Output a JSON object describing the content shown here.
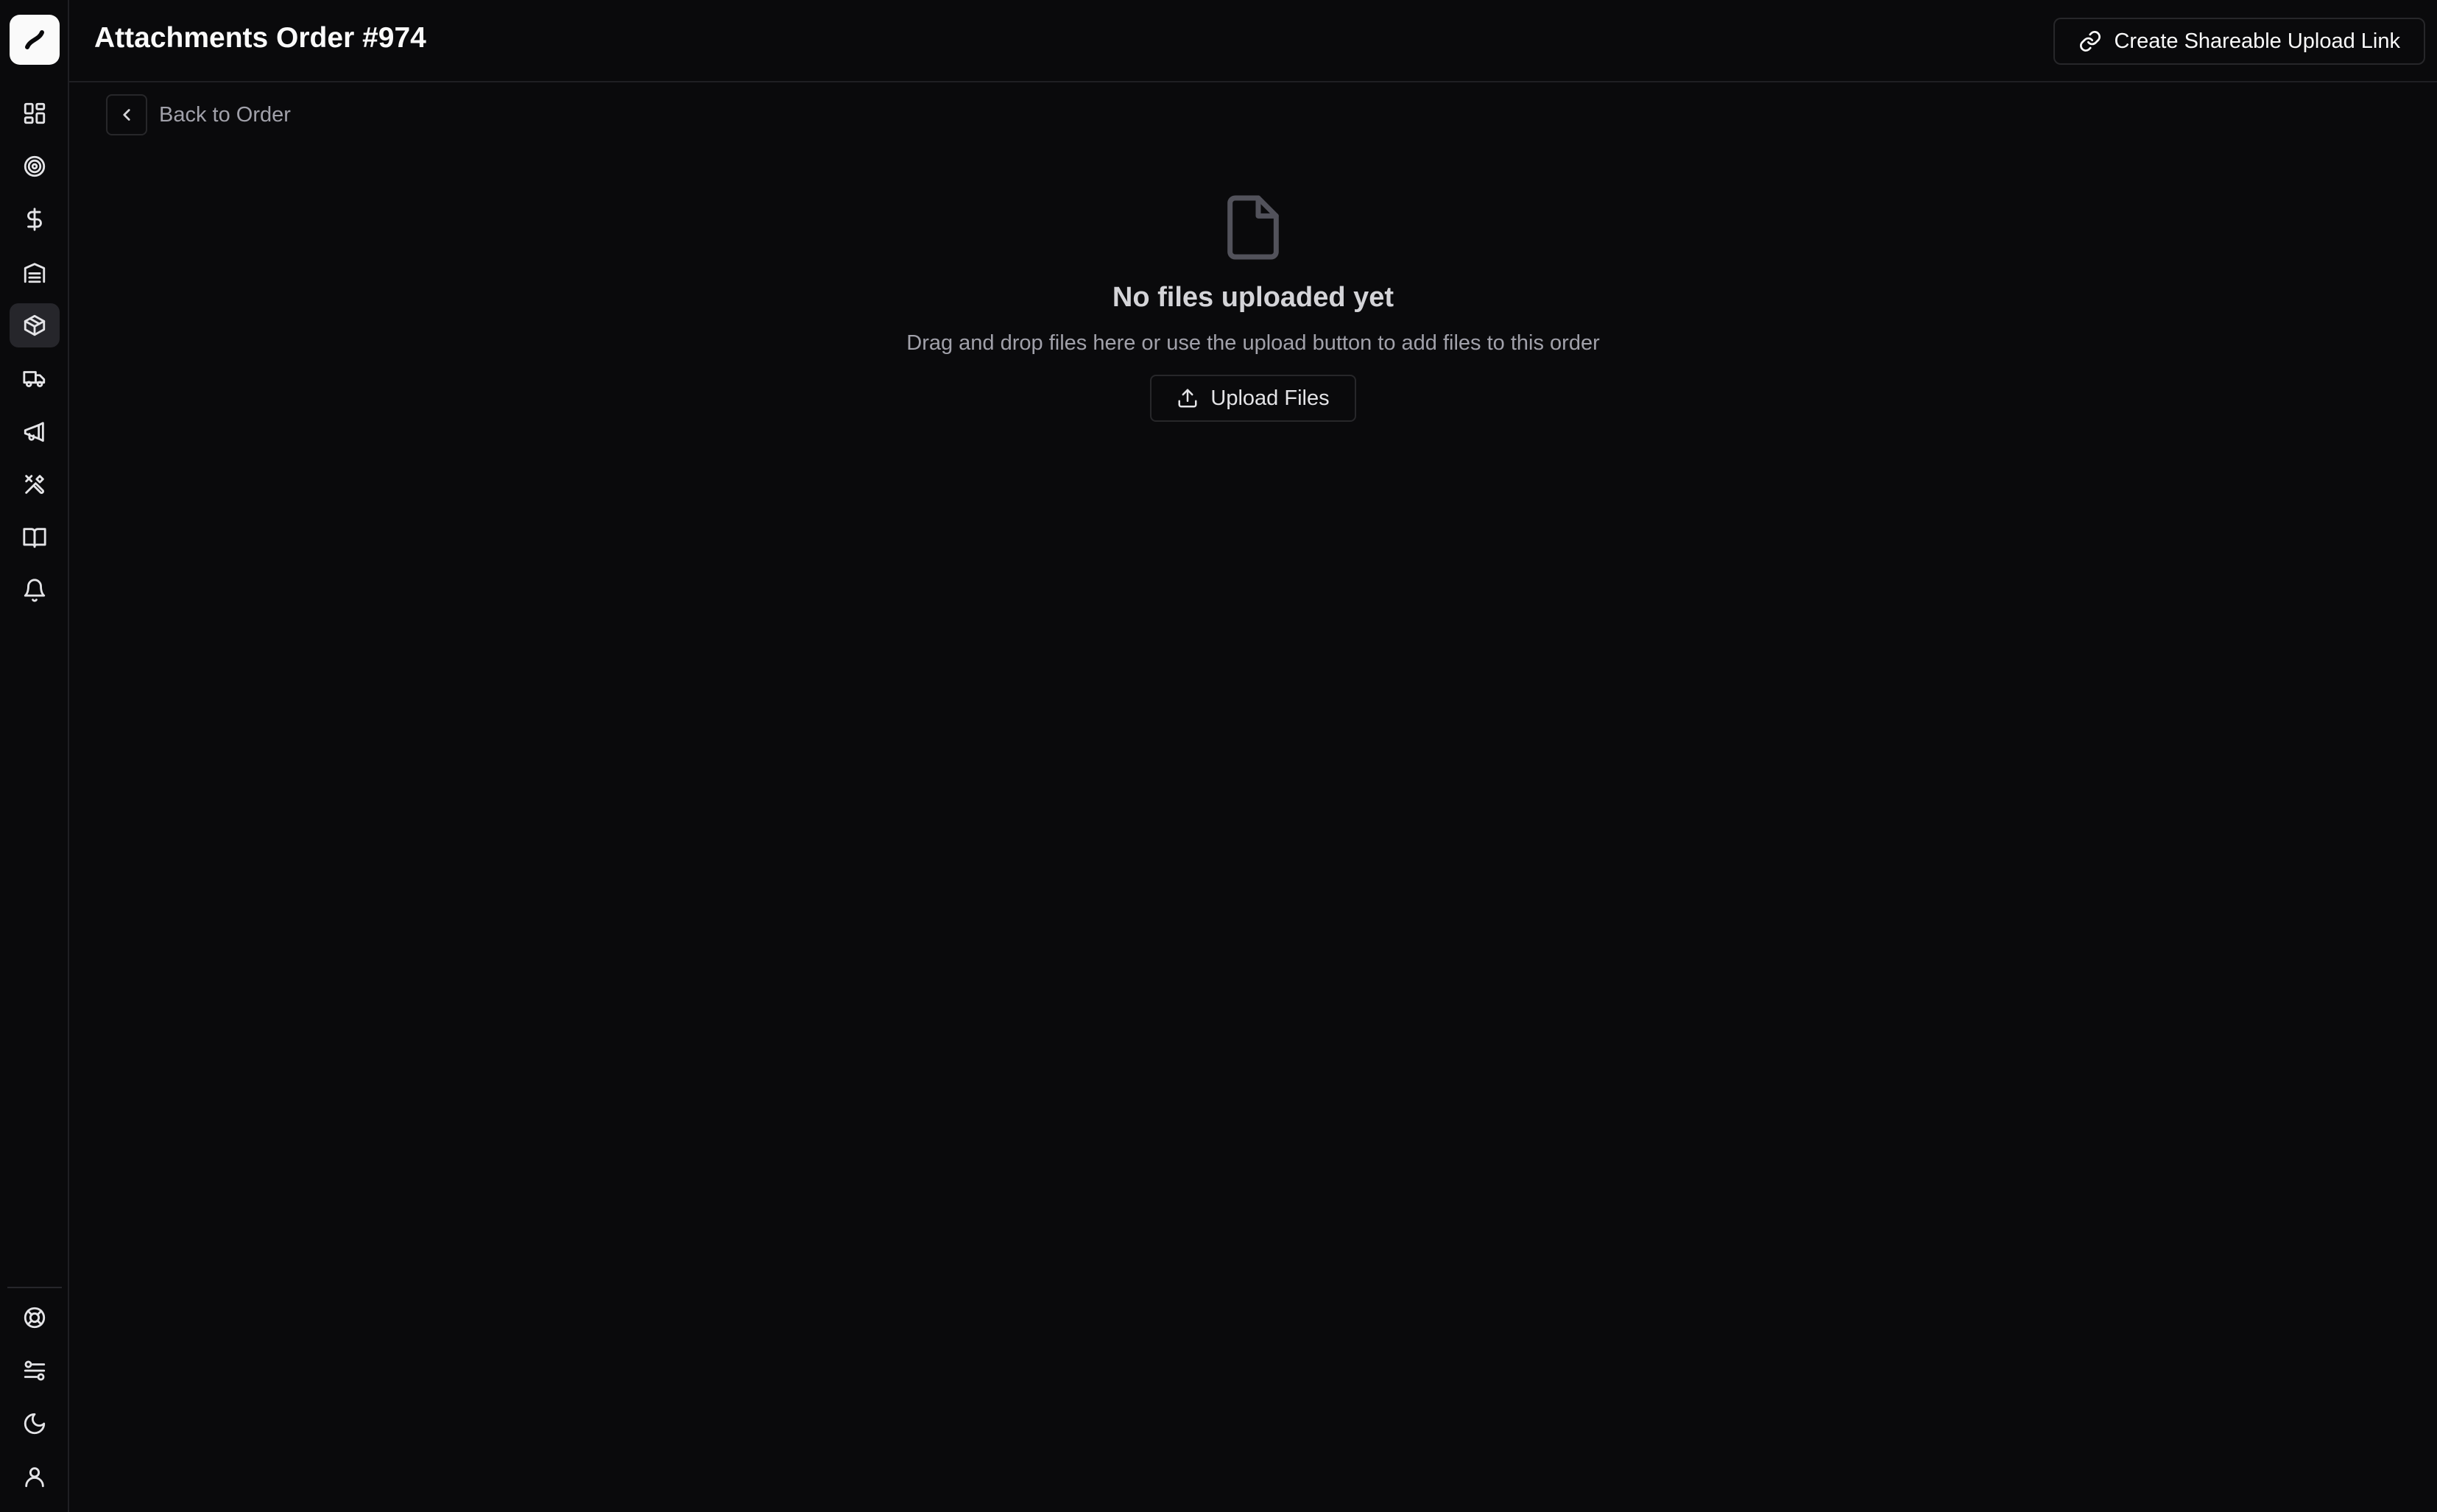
{
  "app": {
    "accent": "#fafafa",
    "background": "#0a0a0c",
    "logo_icon": "brand-logo-icon"
  },
  "header": {
    "title": "Attachments Order #974",
    "share_button": {
      "label": "Create Shareable Upload Link",
      "icon": "link-icon"
    }
  },
  "back": {
    "label": "Back to Order",
    "icon": "chevron-left-icon"
  },
  "sidebar": {
    "items": [
      {
        "id": "dashboard",
        "icon": "dashboard-icon"
      },
      {
        "id": "target",
        "icon": "target-icon"
      },
      {
        "id": "finance",
        "icon": "dollar-icon"
      },
      {
        "id": "warehouse",
        "icon": "warehouse-icon"
      },
      {
        "id": "orders",
        "icon": "package-icon",
        "active": true
      },
      {
        "id": "shipping",
        "icon": "truck-icon"
      },
      {
        "id": "marketing",
        "icon": "megaphone-icon"
      },
      {
        "id": "tools",
        "icon": "tools-icon"
      },
      {
        "id": "docs",
        "icon": "book-icon"
      },
      {
        "id": "notifications",
        "icon": "bell-icon"
      }
    ],
    "bottom": [
      {
        "id": "help",
        "icon": "lifebuoy-icon"
      },
      {
        "id": "settings",
        "icon": "sliders-icon"
      },
      {
        "id": "theme",
        "icon": "moon-icon"
      },
      {
        "id": "account",
        "icon": "user-icon"
      }
    ]
  },
  "empty_state": {
    "icon": "file-icon",
    "title": "No files uploaded yet",
    "description": "Drag and drop files here or use the upload button to add files to this order",
    "upload_button": {
      "label": "Upload Files",
      "icon": "upload-icon"
    }
  }
}
